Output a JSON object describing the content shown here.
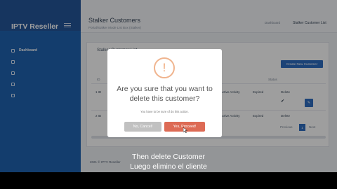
{
  "sidebar": {
    "brand": "IPTV Reseller",
    "items": [
      {
        "label": "Dashboard",
        "active": true
      },
      {
        "label": "",
        "active": false
      },
      {
        "label": "",
        "active": false
      },
      {
        "label": "",
        "active": false
      },
      {
        "label": "",
        "active": false
      }
    ]
  },
  "header": {
    "title": "Stalker Customers",
    "subtitle": "Portal/Stalker Mode List Box (Stalker)",
    "breadcrumb_home": "Dashboard",
    "breadcrumb_current": "Stalker Customer List"
  },
  "panel": {
    "title": "Stalker Customer List",
    "create_button": "Create New Customer",
    "columns": [
      "ID",
      "",
      "",
      "",
      "Status"
    ],
    "rows": [
      {
        "id": "1 ID",
        "status": "Active Activity",
        "expires": "Expired",
        "action": "Delete"
      },
      {
        "id": "2 ID",
        "status": "Active Activity",
        "expires": "Expired",
        "action": "Delete"
      }
    ],
    "pagination": {
      "prev": "Previous",
      "current": "1",
      "next": "Next"
    }
  },
  "footer": {
    "text": "2021 © IPTV Reseller"
  },
  "modal": {
    "icon": "exclamation-icon",
    "title": "Are you sure that you want to delete this customer?",
    "text": "You have to be sure of do this action.",
    "cancel_label": "No, Cancel!",
    "confirm_label": "Yes, Proceed!",
    "colors": {
      "confirm": "#dd6b55",
      "cancel": "#c1c1c1",
      "warning": "#f0b48e"
    }
  },
  "captions": {
    "english": "Then delete Customer",
    "spanish": "Luego elimino el cliente"
  }
}
